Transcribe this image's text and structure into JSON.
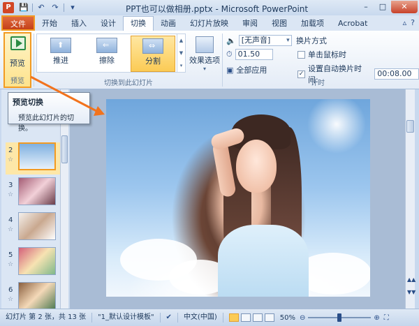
{
  "window": {
    "title": "PPT也可以做相册.pptx - Microsoft PowerPoint",
    "app_icon_letter": "P"
  },
  "qat": {
    "save": "💾",
    "undo": "↶",
    "redo": "↷",
    "customize": "▾"
  },
  "win_controls": {
    "minimize": "–",
    "maximize": "□",
    "close": "✕"
  },
  "tabs": [
    {
      "label": "文件"
    },
    {
      "label": "开始"
    },
    {
      "label": "插入"
    },
    {
      "label": "设计"
    },
    {
      "label": "切换",
      "active": true
    },
    {
      "label": "动画"
    },
    {
      "label": "幻灯片放映"
    },
    {
      "label": "审阅"
    },
    {
      "label": "视图"
    },
    {
      "label": "加载项"
    },
    {
      "label": "Acrobat"
    }
  ],
  "help_icons": {
    "collapse": "▵",
    "help": "?"
  },
  "ribbon": {
    "preview_group": {
      "button_label": "预览",
      "group_label": "预览"
    },
    "transition_group": {
      "items": [
        {
          "label": "推进",
          "glyph": "⬆"
        },
        {
          "label": "擦除",
          "glyph": "⇐"
        },
        {
          "label": "分割",
          "glyph": "⇔",
          "selected": true
        }
      ],
      "effect_options_label": "效果选项",
      "group_label": "切换到此幻灯片"
    },
    "timing_group": {
      "sound_value": "[无声音]",
      "duration_value": "01.50",
      "apply_all_label": "全部应用",
      "advance_title": "换片方式",
      "on_click_label": "单击鼠标时",
      "on_click_checked": false,
      "auto_label": "设置自动换片时间:",
      "auto_checked": true,
      "auto_value": "00:08.00",
      "group_label": "计时"
    }
  },
  "tooltip": {
    "title": "预览切换",
    "body": "预览此幻灯片的切换。"
  },
  "slides": [
    {
      "number": "2",
      "selected": true
    },
    {
      "number": "3"
    },
    {
      "number": "4"
    },
    {
      "number": "5"
    },
    {
      "number": "6"
    }
  ],
  "statusbar": {
    "slide_info": "幻灯片 第 2 张，共 13 张",
    "theme": "\"1_默认设计模板\"",
    "language": "中文(中国)",
    "zoom_percent": "50%",
    "zoom_level": 0.5
  },
  "colors": {
    "accent_orange": "#f29a21",
    "file_tab": "#c4401a",
    "ribbon_text": "#1e395b"
  }
}
